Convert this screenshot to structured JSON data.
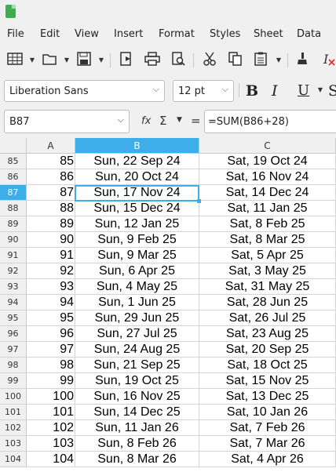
{
  "menu": [
    "File",
    "Edit",
    "View",
    "Insert",
    "Format",
    "Styles",
    "Sheet",
    "Data"
  ],
  "font": {
    "name": "Liberation Sans",
    "size": "12 pt"
  },
  "formula_bar": {
    "cell_ref": "B87",
    "formula": "=SUM(B86+28)",
    "fx": "fx",
    "sigma": "Σ",
    "equals": "="
  },
  "columns": [
    "A",
    "B",
    "C"
  ],
  "selected_cell": "B87",
  "rows": [
    {
      "num": "85",
      "a": "85",
      "b": "Sun, 22 Sep 24",
      "c": "Sat, 19 Oct 24"
    },
    {
      "num": "86",
      "a": "86",
      "b": "Sun, 20 Oct 24",
      "c": "Sat, 16 Nov 24"
    },
    {
      "num": "87",
      "a": "87",
      "b": "Sun, 17 Nov 24",
      "c": "Sat, 14 Dec 24"
    },
    {
      "num": "88",
      "a": "88",
      "b": "Sun, 15 Dec 24",
      "c": "Sat, 11 Jan 25"
    },
    {
      "num": "89",
      "a": "89",
      "b": "Sun, 12 Jan 25",
      "c": "Sat, 8 Feb 25"
    },
    {
      "num": "90",
      "a": "90",
      "b": "Sun, 9 Feb 25",
      "c": "Sat, 8 Mar 25"
    },
    {
      "num": "91",
      "a": "91",
      "b": "Sun, 9 Mar 25",
      "c": "Sat, 5 Apr 25"
    },
    {
      "num": "92",
      "a": "92",
      "b": "Sun, 6 Apr 25",
      "c": "Sat, 3 May 25"
    },
    {
      "num": "93",
      "a": "93",
      "b": "Sun, 4 May 25",
      "c": "Sat, 31 May 25"
    },
    {
      "num": "94",
      "a": "94",
      "b": "Sun, 1 Jun 25",
      "c": "Sat, 28 Jun 25"
    },
    {
      "num": "95",
      "a": "95",
      "b": "Sun, 29 Jun 25",
      "c": "Sat, 26 Jul 25"
    },
    {
      "num": "96",
      "a": "96",
      "b": "Sun, 27 Jul 25",
      "c": "Sat, 23 Aug 25"
    },
    {
      "num": "97",
      "a": "97",
      "b": "Sun, 24 Aug 25",
      "c": "Sat, 20 Sep 25"
    },
    {
      "num": "98",
      "a": "98",
      "b": "Sun, 21 Sep 25",
      "c": "Sat, 18 Oct 25"
    },
    {
      "num": "99",
      "a": "99",
      "b": "Sun, 19 Oct 25",
      "c": "Sat, 15 Nov 25"
    },
    {
      "num": "100",
      "a": "100",
      "b": "Sun, 16 Nov 25",
      "c": "Sat, 13 Dec 25"
    },
    {
      "num": "101",
      "a": "101",
      "b": "Sun, 14 Dec 25",
      "c": "Sat, 10 Jan 26"
    },
    {
      "num": "102",
      "a": "102",
      "b": "Sun, 11 Jan 26",
      "c": "Sat, 7 Feb 26"
    },
    {
      "num": "103",
      "a": "103",
      "b": "Sun, 8 Feb 26",
      "c": "Sat, 7 Mar 26"
    },
    {
      "num": "104",
      "a": "104",
      "b": "Sun, 8 Mar 26",
      "c": "Sat, 4 Apr 26"
    }
  ],
  "colors": {
    "selection": "#3daee9",
    "app_icon": "#3dae4c"
  }
}
